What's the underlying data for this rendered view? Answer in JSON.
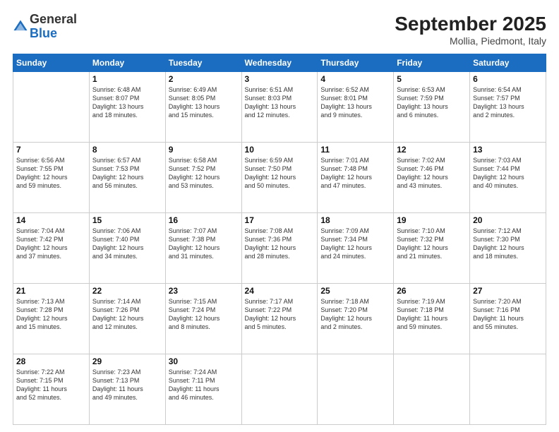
{
  "header": {
    "logo_general": "General",
    "logo_blue": "Blue",
    "month": "September 2025",
    "location": "Mollia, Piedmont, Italy"
  },
  "days_of_week": [
    "Sunday",
    "Monday",
    "Tuesday",
    "Wednesday",
    "Thursday",
    "Friday",
    "Saturday"
  ],
  "weeks": [
    [
      {
        "day": "",
        "text": ""
      },
      {
        "day": "1",
        "text": "Sunrise: 6:48 AM\nSunset: 8:07 PM\nDaylight: 13 hours\nand 18 minutes."
      },
      {
        "day": "2",
        "text": "Sunrise: 6:49 AM\nSunset: 8:05 PM\nDaylight: 13 hours\nand 15 minutes."
      },
      {
        "day": "3",
        "text": "Sunrise: 6:51 AM\nSunset: 8:03 PM\nDaylight: 13 hours\nand 12 minutes."
      },
      {
        "day": "4",
        "text": "Sunrise: 6:52 AM\nSunset: 8:01 PM\nDaylight: 13 hours\nand 9 minutes."
      },
      {
        "day": "5",
        "text": "Sunrise: 6:53 AM\nSunset: 7:59 PM\nDaylight: 13 hours\nand 6 minutes."
      },
      {
        "day": "6",
        "text": "Sunrise: 6:54 AM\nSunset: 7:57 PM\nDaylight: 13 hours\nand 2 minutes."
      }
    ],
    [
      {
        "day": "7",
        "text": "Sunrise: 6:56 AM\nSunset: 7:55 PM\nDaylight: 12 hours\nand 59 minutes."
      },
      {
        "day": "8",
        "text": "Sunrise: 6:57 AM\nSunset: 7:53 PM\nDaylight: 12 hours\nand 56 minutes."
      },
      {
        "day": "9",
        "text": "Sunrise: 6:58 AM\nSunset: 7:52 PM\nDaylight: 12 hours\nand 53 minutes."
      },
      {
        "day": "10",
        "text": "Sunrise: 6:59 AM\nSunset: 7:50 PM\nDaylight: 12 hours\nand 50 minutes."
      },
      {
        "day": "11",
        "text": "Sunrise: 7:01 AM\nSunset: 7:48 PM\nDaylight: 12 hours\nand 47 minutes."
      },
      {
        "day": "12",
        "text": "Sunrise: 7:02 AM\nSunset: 7:46 PM\nDaylight: 12 hours\nand 43 minutes."
      },
      {
        "day": "13",
        "text": "Sunrise: 7:03 AM\nSunset: 7:44 PM\nDaylight: 12 hours\nand 40 minutes."
      }
    ],
    [
      {
        "day": "14",
        "text": "Sunrise: 7:04 AM\nSunset: 7:42 PM\nDaylight: 12 hours\nand 37 minutes."
      },
      {
        "day": "15",
        "text": "Sunrise: 7:06 AM\nSunset: 7:40 PM\nDaylight: 12 hours\nand 34 minutes."
      },
      {
        "day": "16",
        "text": "Sunrise: 7:07 AM\nSunset: 7:38 PM\nDaylight: 12 hours\nand 31 minutes."
      },
      {
        "day": "17",
        "text": "Sunrise: 7:08 AM\nSunset: 7:36 PM\nDaylight: 12 hours\nand 28 minutes."
      },
      {
        "day": "18",
        "text": "Sunrise: 7:09 AM\nSunset: 7:34 PM\nDaylight: 12 hours\nand 24 minutes."
      },
      {
        "day": "19",
        "text": "Sunrise: 7:10 AM\nSunset: 7:32 PM\nDaylight: 12 hours\nand 21 minutes."
      },
      {
        "day": "20",
        "text": "Sunrise: 7:12 AM\nSunset: 7:30 PM\nDaylight: 12 hours\nand 18 minutes."
      }
    ],
    [
      {
        "day": "21",
        "text": "Sunrise: 7:13 AM\nSunset: 7:28 PM\nDaylight: 12 hours\nand 15 minutes."
      },
      {
        "day": "22",
        "text": "Sunrise: 7:14 AM\nSunset: 7:26 PM\nDaylight: 12 hours\nand 12 minutes."
      },
      {
        "day": "23",
        "text": "Sunrise: 7:15 AM\nSunset: 7:24 PM\nDaylight: 12 hours\nand 8 minutes."
      },
      {
        "day": "24",
        "text": "Sunrise: 7:17 AM\nSunset: 7:22 PM\nDaylight: 12 hours\nand 5 minutes."
      },
      {
        "day": "25",
        "text": "Sunrise: 7:18 AM\nSunset: 7:20 PM\nDaylight: 12 hours\nand 2 minutes."
      },
      {
        "day": "26",
        "text": "Sunrise: 7:19 AM\nSunset: 7:18 PM\nDaylight: 11 hours\nand 59 minutes."
      },
      {
        "day": "27",
        "text": "Sunrise: 7:20 AM\nSunset: 7:16 PM\nDaylight: 11 hours\nand 55 minutes."
      }
    ],
    [
      {
        "day": "28",
        "text": "Sunrise: 7:22 AM\nSunset: 7:15 PM\nDaylight: 11 hours\nand 52 minutes."
      },
      {
        "day": "29",
        "text": "Sunrise: 7:23 AM\nSunset: 7:13 PM\nDaylight: 11 hours\nand 49 minutes."
      },
      {
        "day": "30",
        "text": "Sunrise: 7:24 AM\nSunset: 7:11 PM\nDaylight: 11 hours\nand 46 minutes."
      },
      {
        "day": "",
        "text": ""
      },
      {
        "day": "",
        "text": ""
      },
      {
        "day": "",
        "text": ""
      },
      {
        "day": "",
        "text": ""
      }
    ]
  ]
}
